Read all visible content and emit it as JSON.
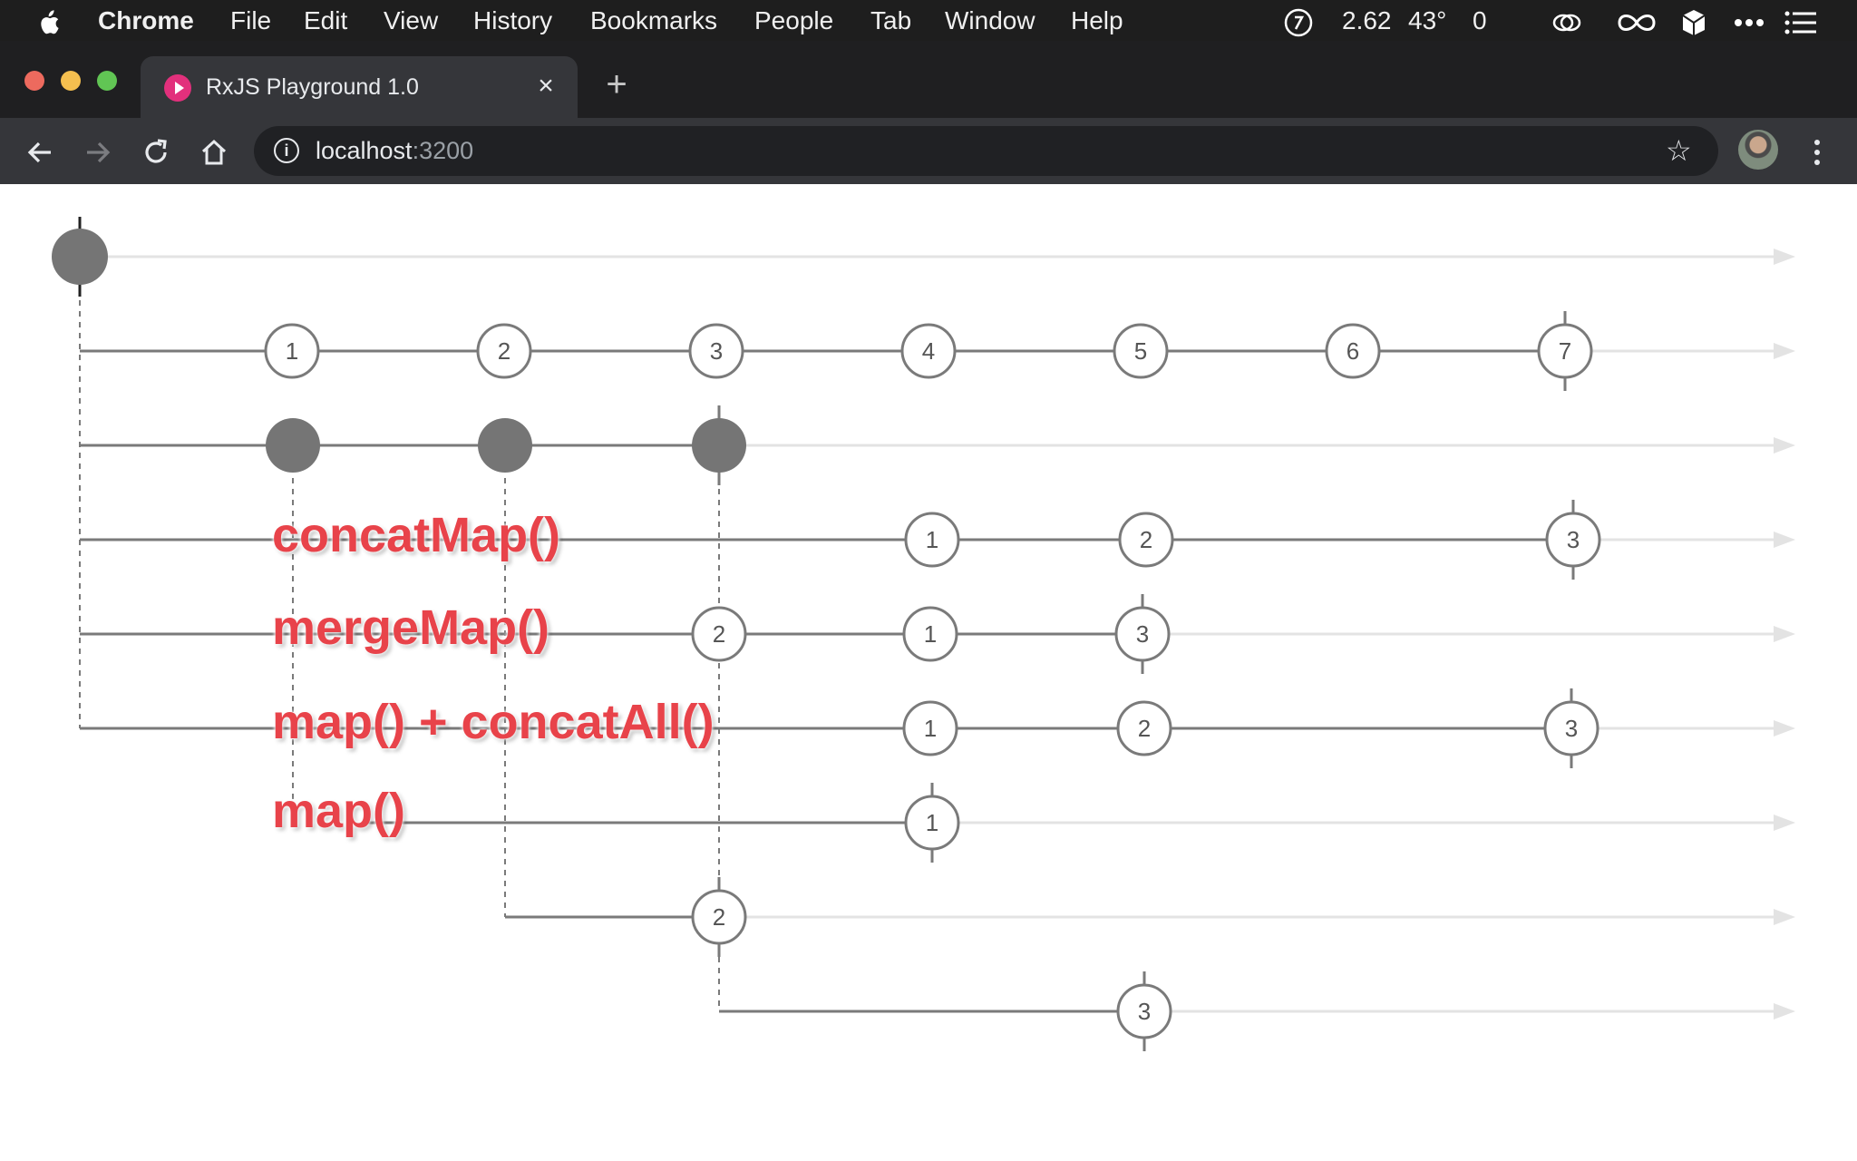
{
  "menubar": {
    "apple_icon": "apple-icon",
    "items": [
      {
        "label": "Chrome",
        "bold": true
      },
      {
        "label": "File"
      },
      {
        "label": "Edit"
      },
      {
        "label": "View"
      },
      {
        "label": "History"
      },
      {
        "label": "Bookmarks"
      },
      {
        "label": "People"
      },
      {
        "label": "Tab"
      },
      {
        "label": "Window"
      },
      {
        "label": "Help"
      }
    ],
    "status": {
      "load": "2.62",
      "temp": "43°",
      "count": "0"
    },
    "status_icons": [
      "clock-icon",
      "creative-cloud-icon",
      "infinity-icon",
      "cube-icon",
      "ellipsis-icon",
      "list-icon"
    ]
  },
  "browser": {
    "tab_title": "RxJS Playground 1.0",
    "tab_close": "×",
    "new_tab": "+",
    "url_host": "localhost",
    "url_port": ":3200"
  },
  "diagram": {
    "source": {
      "values": []
    },
    "counter": {
      "values": [
        "1",
        "2",
        "3",
        "4",
        "5",
        "6",
        "7"
      ]
    },
    "inner_sources": {
      "values": []
    },
    "operators": [
      {
        "label": "concatMap()",
        "values": [
          "1",
          "2",
          "3"
        ]
      },
      {
        "label": "mergeMap()",
        "values": [
          "2",
          "1",
          "3"
        ]
      },
      {
        "label": "map() + concatAll()",
        "values": [
          "1",
          "2",
          "3"
        ]
      },
      {
        "label": "map()",
        "values": [
          "1"
        ]
      }
    ],
    "inner_2": {
      "values": [
        "2"
      ]
    },
    "inner_3": {
      "values": [
        "3"
      ]
    }
  },
  "colors": {
    "line": "#7a7a7a",
    "faint": "#e3e3e3",
    "filled": "#757575",
    "label": "#e8434a"
  }
}
